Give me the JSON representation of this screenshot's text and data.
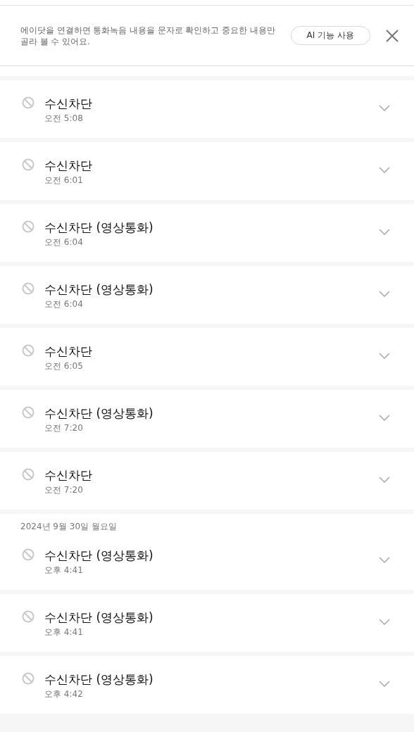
{
  "banner": {
    "message": "에이닷을 연결하면 통화녹음 내용을 문자로 확인하고 중요한 내용만 골라 볼 수 있어요.",
    "button": "AI 기능 사용"
  },
  "groups": [
    {
      "calls": [
        {
          "title": "수신차단",
          "time": "오전 5:08"
        },
        {
          "title": "수신차단",
          "time": "오전 6:01"
        },
        {
          "title": "수신차단 (영상통화)",
          "time": "오전 6:04"
        },
        {
          "title": "수신차단 (영상통화)",
          "time": "오전 6:04"
        },
        {
          "title": "수신차단",
          "time": "오전 6:05"
        },
        {
          "title": "수신차단 (영상통화)",
          "time": "오전 7:20"
        },
        {
          "title": "수신차단",
          "time": "오전 7:20"
        }
      ]
    },
    {
      "date": "2024년 9월 30일 월요일",
      "calls": [
        {
          "title": "수신차단 (영상통화)",
          "time": "오후 4:41"
        },
        {
          "title": "수신차단 (영상통화)",
          "time": "오후 4:41"
        },
        {
          "title": "수신차단 (영상통화)",
          "time": "오후 4:42"
        }
      ]
    }
  ]
}
